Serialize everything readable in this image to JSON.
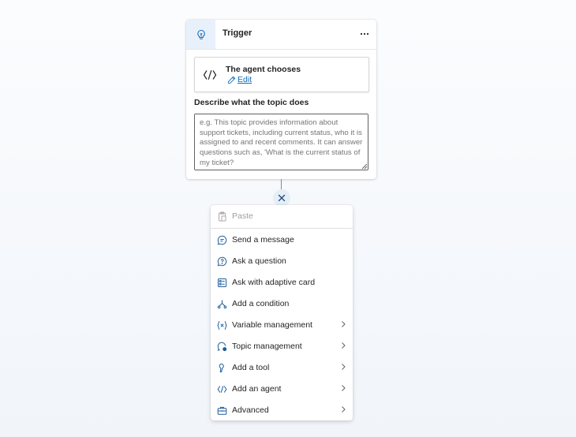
{
  "trigger": {
    "title": "Trigger",
    "option_title": "The agent chooses",
    "edit_label": "Edit",
    "describe_label": "Describe what the topic does",
    "describe_placeholder": "e.g. This topic provides information about support tickets, including current status, who it is assigned to and recent comments. It can answer questions such as, 'What is the current status of my ticket?",
    "header_icon": "trigger-icon",
    "more_icon": "more-horizontal-icon"
  },
  "menu": {
    "paste_label": "Paste",
    "items": [
      {
        "label": "Send a message",
        "icon": "message-icon",
        "submenu": false
      },
      {
        "label": "Ask a question",
        "icon": "question-icon",
        "submenu": false
      },
      {
        "label": "Ask with adaptive card",
        "icon": "adaptive-card-icon",
        "submenu": false
      },
      {
        "label": "Add a condition",
        "icon": "branch-icon",
        "submenu": false
      },
      {
        "label": "Variable management",
        "icon": "variable-icon",
        "submenu": true
      },
      {
        "label": "Topic management",
        "icon": "topic-icon",
        "submenu": true
      },
      {
        "label": "Add a tool",
        "icon": "tool-icon",
        "submenu": true
      },
      {
        "label": "Add an agent",
        "icon": "agent-icon",
        "submenu": true
      },
      {
        "label": "Advanced",
        "icon": "toolbox-icon",
        "submenu": true
      }
    ]
  },
  "colors": {
    "accent": "#0f6cbd",
    "icon_blue": "#1f5e99",
    "header_bg": "#e8f1fb"
  }
}
